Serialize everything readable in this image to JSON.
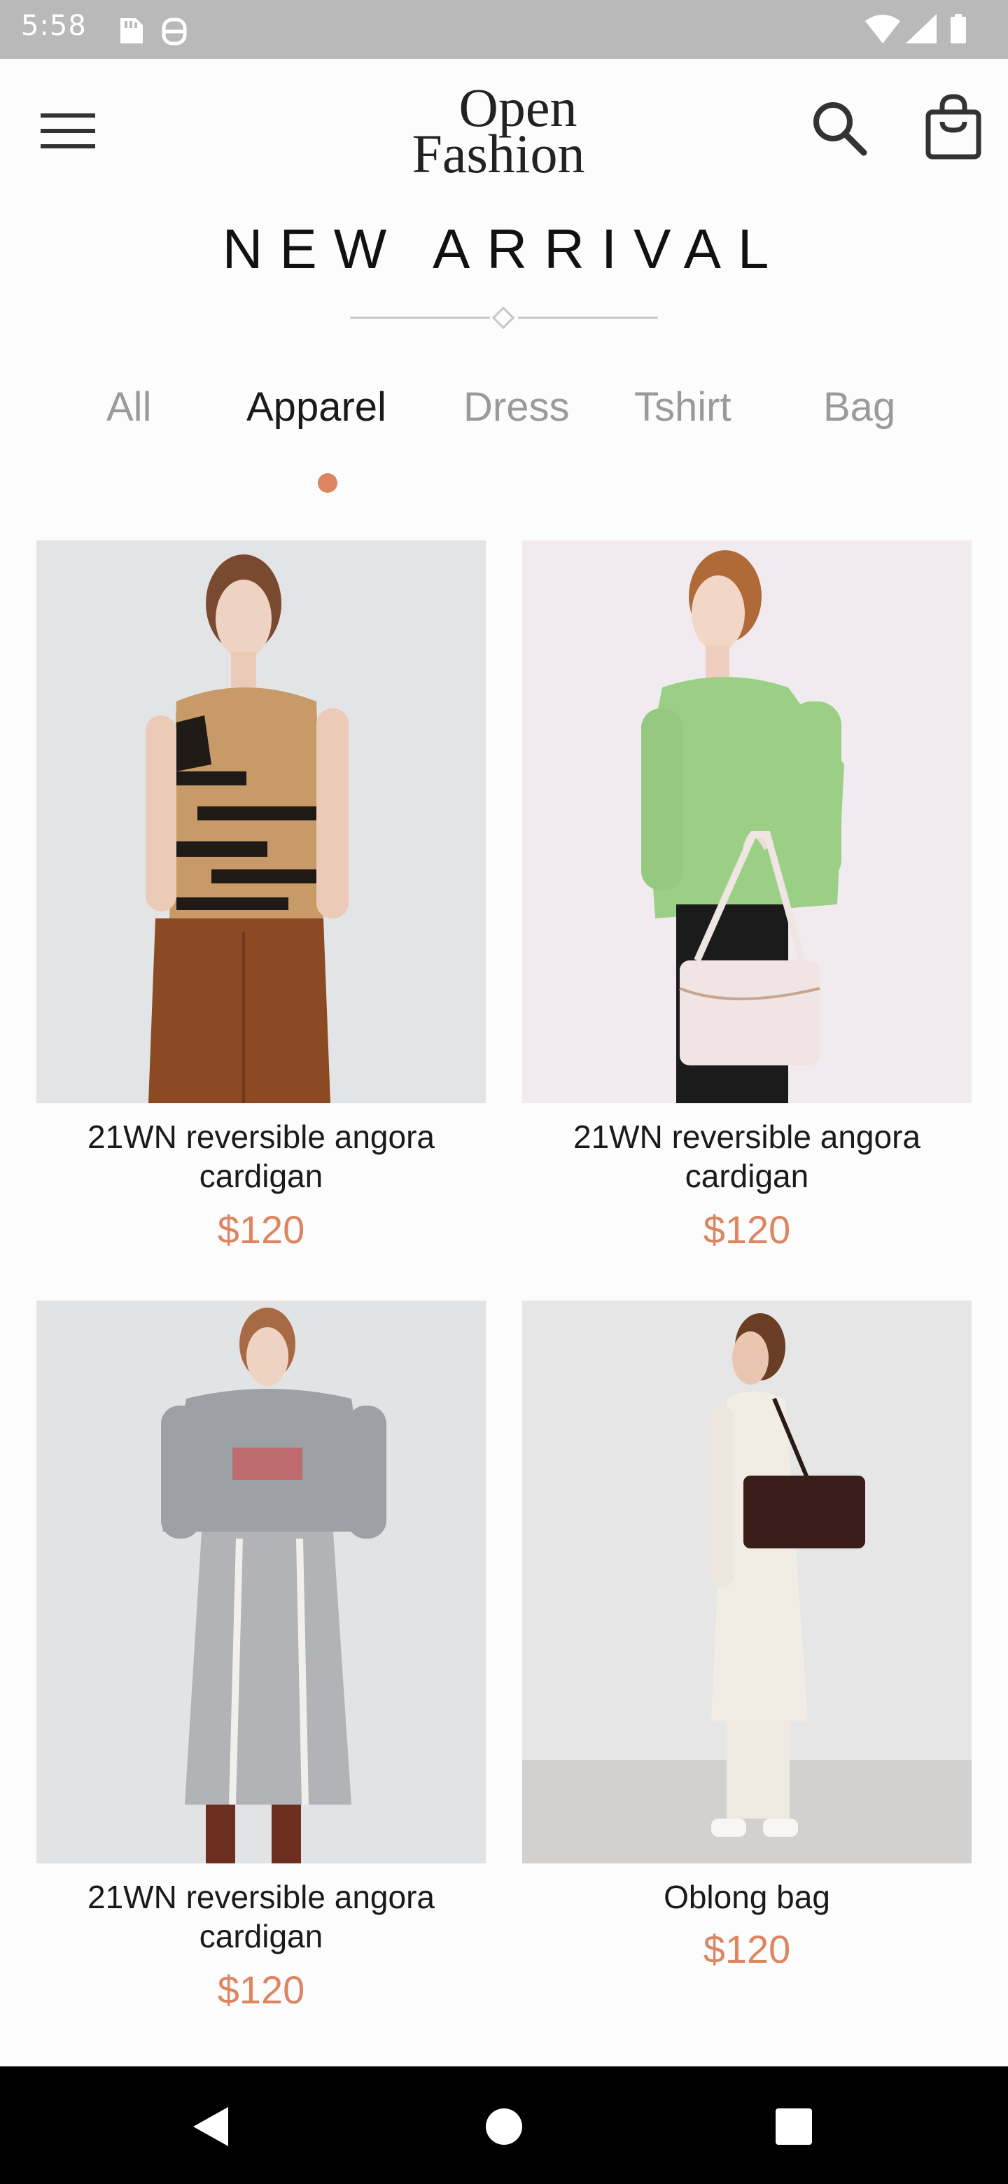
{
  "status_bar": {
    "time": "5:58",
    "icons_left": [
      "sd-card-icon",
      "android-debug-icon"
    ],
    "icons_right": [
      "wifi-icon",
      "signal-icon",
      "battery-icon"
    ]
  },
  "header": {
    "logo_line1": "Open",
    "logo_line2": "Fashion",
    "icons": [
      "menu-icon",
      "search-icon",
      "shopping-bag-icon"
    ]
  },
  "section_title": "NEW ARRIVAL",
  "tabs": [
    {
      "label": "All",
      "active": false
    },
    {
      "label": "Apparel",
      "active": true
    },
    {
      "label": "Dress",
      "active": false
    },
    {
      "label": "Tshirt",
      "active": false
    },
    {
      "label": "Bag",
      "active": false
    }
  ],
  "products": [
    {
      "name": "21WN reversible angora cardigan",
      "price": "$120"
    },
    {
      "name": "21WN reversible angora cardigan",
      "price": "$120"
    },
    {
      "name": "21WN reversible angora cardigan",
      "price": "$120"
    },
    {
      "name": "Oblong bag",
      "price": "$120"
    }
  ],
  "colors": {
    "accent": "#dd8560",
    "text": "#1a1a1a",
    "inactive_tab": "#9a9a9a",
    "status_bar": "#b9b9b9",
    "background": "#fcfcfc"
  },
  "nav_bar": {
    "icons": [
      "back-icon",
      "home-icon",
      "recents-icon"
    ]
  }
}
